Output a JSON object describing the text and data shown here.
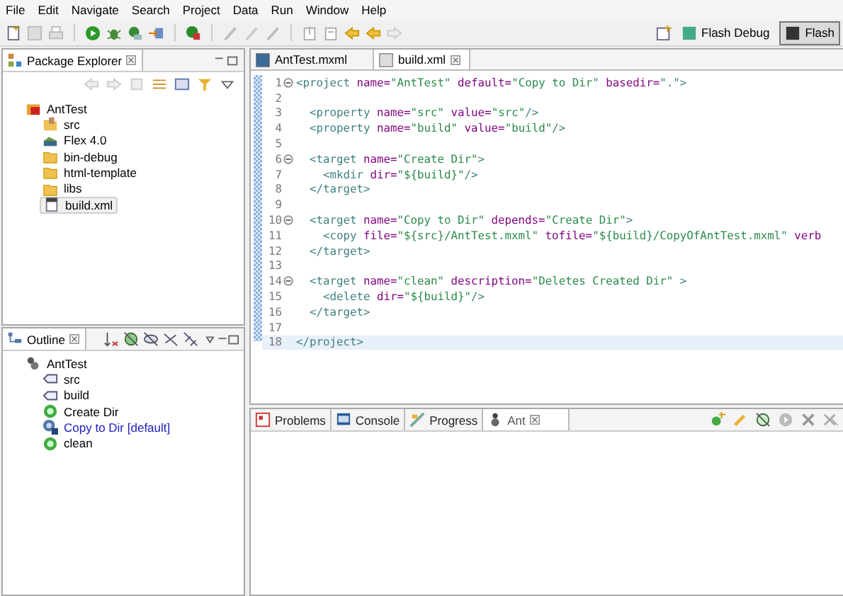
{
  "menu": [
    "File",
    "Edit",
    "Navigate",
    "Search",
    "Project",
    "Data",
    "Run",
    "Window",
    "Help"
  ],
  "perspectives": [
    {
      "label": "Flash Debug",
      "selected": false
    },
    {
      "label": "Flash",
      "selected": true
    }
  ],
  "package_explorer": {
    "title": "Package Explorer",
    "tree": [
      {
        "label": "AntTest",
        "kind": "project",
        "selected": false,
        "children": [
          {
            "label": "src",
            "kind": "source-folder",
            "selected": false
          },
          {
            "label": "Flex 4.0",
            "kind": "library",
            "selected": false
          },
          {
            "label": "bin-debug",
            "kind": "folder",
            "selected": false
          },
          {
            "label": "html-template",
            "kind": "folder",
            "selected": false
          },
          {
            "label": "libs",
            "kind": "folder",
            "selected": false
          },
          {
            "label": "build.xml",
            "kind": "file",
            "selected": true
          }
        ]
      }
    ]
  },
  "outline": {
    "title": "Outline",
    "tree": [
      {
        "label": "AntTest",
        "kind": "project",
        "children": [
          {
            "label": "src",
            "kind": "property"
          },
          {
            "label": "build",
            "kind": "property"
          },
          {
            "label": "Create Dir",
            "kind": "target"
          },
          {
            "label": "Copy to Dir [default]",
            "kind": "default-target"
          },
          {
            "label": "clean",
            "kind": "target"
          }
        ]
      }
    ]
  },
  "editor": {
    "tabs": [
      {
        "label": "AntTest.mxml",
        "selected": false
      },
      {
        "label": "build.xml",
        "selected": true
      }
    ],
    "lines": [
      {
        "number": "1",
        "fold": true,
        "current": false,
        "tokens": [
          {
            "kind": "tag",
            "text": "<project"
          },
          {
            "kind": "attr",
            "text": " name="
          },
          {
            "kind": "string",
            "text": "\"AntTest\""
          },
          {
            "kind": "attr",
            "text": " default="
          },
          {
            "kind": "string",
            "text": "\"Copy to Dir\""
          },
          {
            "kind": "attr",
            "text": " basedir="
          },
          {
            "kind": "string",
            "text": "\".\""
          },
          {
            "kind": "tag",
            "text": ">"
          }
        ]
      },
      {
        "number": "2",
        "fold": false,
        "current": false
      },
      {
        "number": "3",
        "fold": false,
        "current": false,
        "tokens": [
          {
            "kind": "tag",
            "text": "  <property"
          },
          {
            "kind": "attr",
            "text": " name="
          },
          {
            "kind": "string",
            "text": "\"src\""
          },
          {
            "kind": "attr",
            "text": " value="
          },
          {
            "kind": "string",
            "text": "\"src\""
          },
          {
            "kind": "tag",
            "text": "/>"
          }
        ]
      },
      {
        "number": "4",
        "fold": false,
        "current": false,
        "tokens": [
          {
            "kind": "tag",
            "text": "  <property"
          },
          {
            "kind": "attr",
            "text": " name="
          },
          {
            "kind": "string",
            "text": "\"build\""
          },
          {
            "kind": "attr",
            "text": " value="
          },
          {
            "kind": "string",
            "text": "\"build\""
          },
          {
            "kind": "tag",
            "text": "/>"
          }
        ]
      },
      {
        "number": "5",
        "fold": false,
        "current": false
      },
      {
        "number": "6",
        "fold": true,
        "current": false,
        "tokens": [
          {
            "kind": "tag",
            "text": "  <target"
          },
          {
            "kind": "attr",
            "text": " name="
          },
          {
            "kind": "string",
            "text": "\"Create Dir\""
          },
          {
            "kind": "tag",
            "text": ">"
          }
        ]
      },
      {
        "number": "7",
        "fold": false,
        "current": false,
        "tokens": [
          {
            "kind": "tag",
            "text": "    <mkdir"
          },
          {
            "kind": "attr",
            "text": " dir="
          },
          {
            "kind": "string",
            "text": "\"${build}\""
          },
          {
            "kind": "tag",
            "text": "/>"
          }
        ]
      },
      {
        "number": "8",
        "fold": false,
        "current": false,
        "tokens": [
          {
            "kind": "tag",
            "text": "  </target>"
          }
        ]
      },
      {
        "number": "9",
        "fold": false,
        "current": false
      },
      {
        "number": "10",
        "fold": true,
        "current": false,
        "tokens": [
          {
            "kind": "tag",
            "text": "  <target"
          },
          {
            "kind": "attr",
            "text": " name="
          },
          {
            "kind": "string",
            "text": "\"Copy to Dir\""
          },
          {
            "kind": "attr",
            "text": " depends="
          },
          {
            "kind": "string",
            "text": "\"Create Dir\""
          },
          {
            "kind": "tag",
            "text": ">"
          }
        ]
      },
      {
        "number": "11",
        "fold": false,
        "current": false,
        "tokens": [
          {
            "kind": "tag",
            "text": "    <copy"
          },
          {
            "kind": "attr",
            "text": " file="
          },
          {
            "kind": "string",
            "text": "\"${src}/AntTest.mxml\""
          },
          {
            "kind": "attr",
            "text": " tofile="
          },
          {
            "kind": "string",
            "text": "\"${build}/CopyOfAntTest.mxml\""
          },
          {
            "kind": "attr",
            "text": " verb"
          }
        ]
      },
      {
        "number": "12",
        "fold": false,
        "current": false,
        "tokens": [
          {
            "kind": "tag",
            "text": "  </target>"
          }
        ]
      },
      {
        "number": "13",
        "fold": false,
        "current": false
      },
      {
        "number": "14",
        "fold": true,
        "current": false,
        "tokens": [
          {
            "kind": "tag",
            "text": "  <target"
          },
          {
            "kind": "attr",
            "text": " name="
          },
          {
            "kind": "string",
            "text": "\"clean\""
          },
          {
            "kind": "attr",
            "text": " description="
          },
          {
            "kind": "string",
            "text": "\"Deletes Created Dir\""
          },
          {
            "kind": "tag",
            "text": " >"
          }
        ]
      },
      {
        "number": "15",
        "fold": false,
        "current": false,
        "tokens": [
          {
            "kind": "tag",
            "text": "    <delete"
          },
          {
            "kind": "attr",
            "text": " dir="
          },
          {
            "kind": "string",
            "text": "\"${build}\""
          },
          {
            "kind": "tag",
            "text": "/>"
          }
        ]
      },
      {
        "number": "16",
        "fold": false,
        "current": false,
        "tokens": [
          {
            "kind": "tag",
            "text": "  </target>"
          }
        ]
      },
      {
        "number": "17",
        "fold": false,
        "current": false
      },
      {
        "number": "18",
        "fold": false,
        "current": true,
        "tokens": [
          {
            "kind": "tag",
            "text": "</project>"
          }
        ]
      }
    ]
  },
  "bottom_panel": {
    "tabs": [
      {
        "label": "Problems",
        "kind": "problems",
        "selected": false
      },
      {
        "label": "Console",
        "kind": "console",
        "selected": false
      },
      {
        "label": "Progress",
        "kind": "progress",
        "selected": false
      },
      {
        "label": "Ant",
        "kind": "ant",
        "selected": true
      }
    ]
  }
}
